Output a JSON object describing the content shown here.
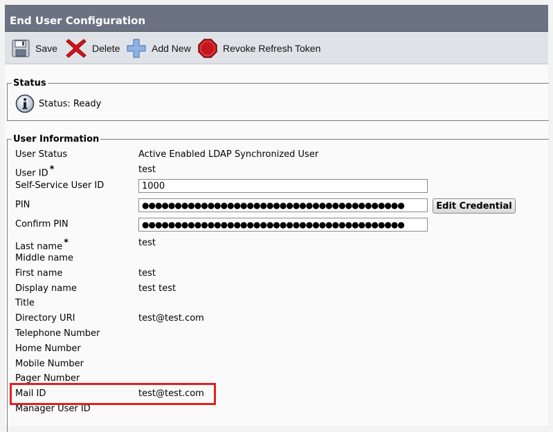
{
  "window": {
    "title": "End User Configuration"
  },
  "toolbar": {
    "save_label": "Save",
    "delete_label": "Delete",
    "add_new_label": "Add New",
    "revoke_label": "Revoke Refresh Token",
    "icons": [
      "floppy-disk-icon",
      "red-x-icon",
      "blue-plus-icon",
      "stop-sign-icon"
    ]
  },
  "status": {
    "section_title": "Status",
    "text": "Status: Ready",
    "icon": "info-icon"
  },
  "user_info": {
    "section_title": "User Information",
    "required_mark": "*",
    "user_status_label": "User Status",
    "user_status_value": "Active Enabled LDAP Synchronized User",
    "user_id_label": "User ID",
    "user_id_value": "test",
    "self_service_label": "Self-Service User ID",
    "self_service_value": "1000",
    "pin_label": "PIN",
    "pin_value": "●●●●●●●●●●●●●●●●●●●●●●●●●●●●●●●●●●●●●●●●",
    "edit_credential_label": "Edit Credential",
    "confirm_pin_label": "Confirm PIN",
    "confirm_pin_value": "●●●●●●●●●●●●●●●●●●●●●●●●●●●●●●●●●●●●●●●●",
    "last_name_label": "Last name",
    "last_name_value": "test",
    "middle_name_label": "Middle name",
    "first_name_label": "First name",
    "first_name_value": "test",
    "display_name_label": "Display name",
    "display_name_value": "test test",
    "title_label": "Title",
    "directory_uri_label": "Directory URI",
    "directory_uri_value": "test@test.com",
    "telephone_label": "Telephone Number",
    "home_label": "Home Number",
    "mobile_label": "Mobile Number",
    "pager_label": "Pager Number",
    "mail_id_label": "Mail ID",
    "mail_id_value": "test@test.com",
    "manager_label": "Manager User ID"
  },
  "colors": {
    "titlebar": "#6b7281",
    "toolbar": "#dfe2e7",
    "highlight": "#e0201f"
  }
}
